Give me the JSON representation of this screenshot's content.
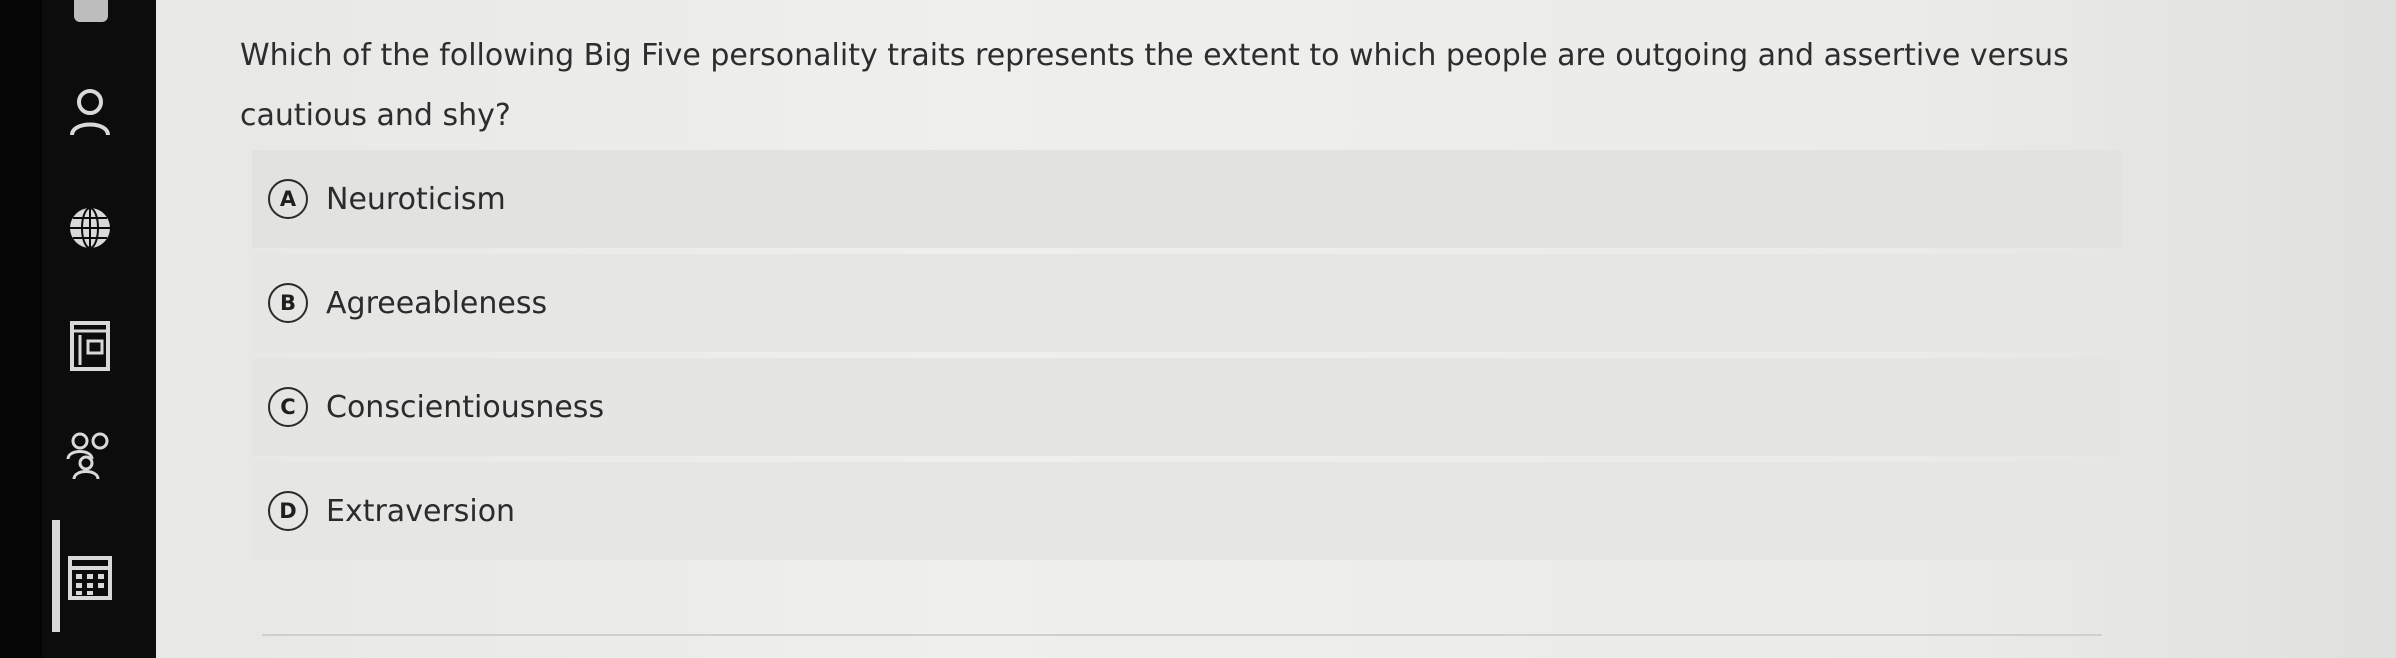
{
  "question": {
    "text": "Which of the following Big Five personality traits represents the extent to which people are outgoing and assertive versus cautious and shy?"
  },
  "options": [
    {
      "letter": "A",
      "label": "Neuroticism"
    },
    {
      "letter": "B",
      "label": "Agreeableness"
    },
    {
      "letter": "C",
      "label": "Conscientiousness"
    },
    {
      "letter": "D",
      "label": "Extraversion"
    }
  ],
  "sidebar": {
    "icons": [
      "user-icon",
      "globe-icon",
      "book-icon",
      "people-icon",
      "calendar-icon"
    ]
  },
  "colors": {
    "sidebar_bg": "#0c0c0c",
    "page_bg": "#ececea",
    "option_bg": "#e4e4e2",
    "text": "#2b2b2b"
  }
}
